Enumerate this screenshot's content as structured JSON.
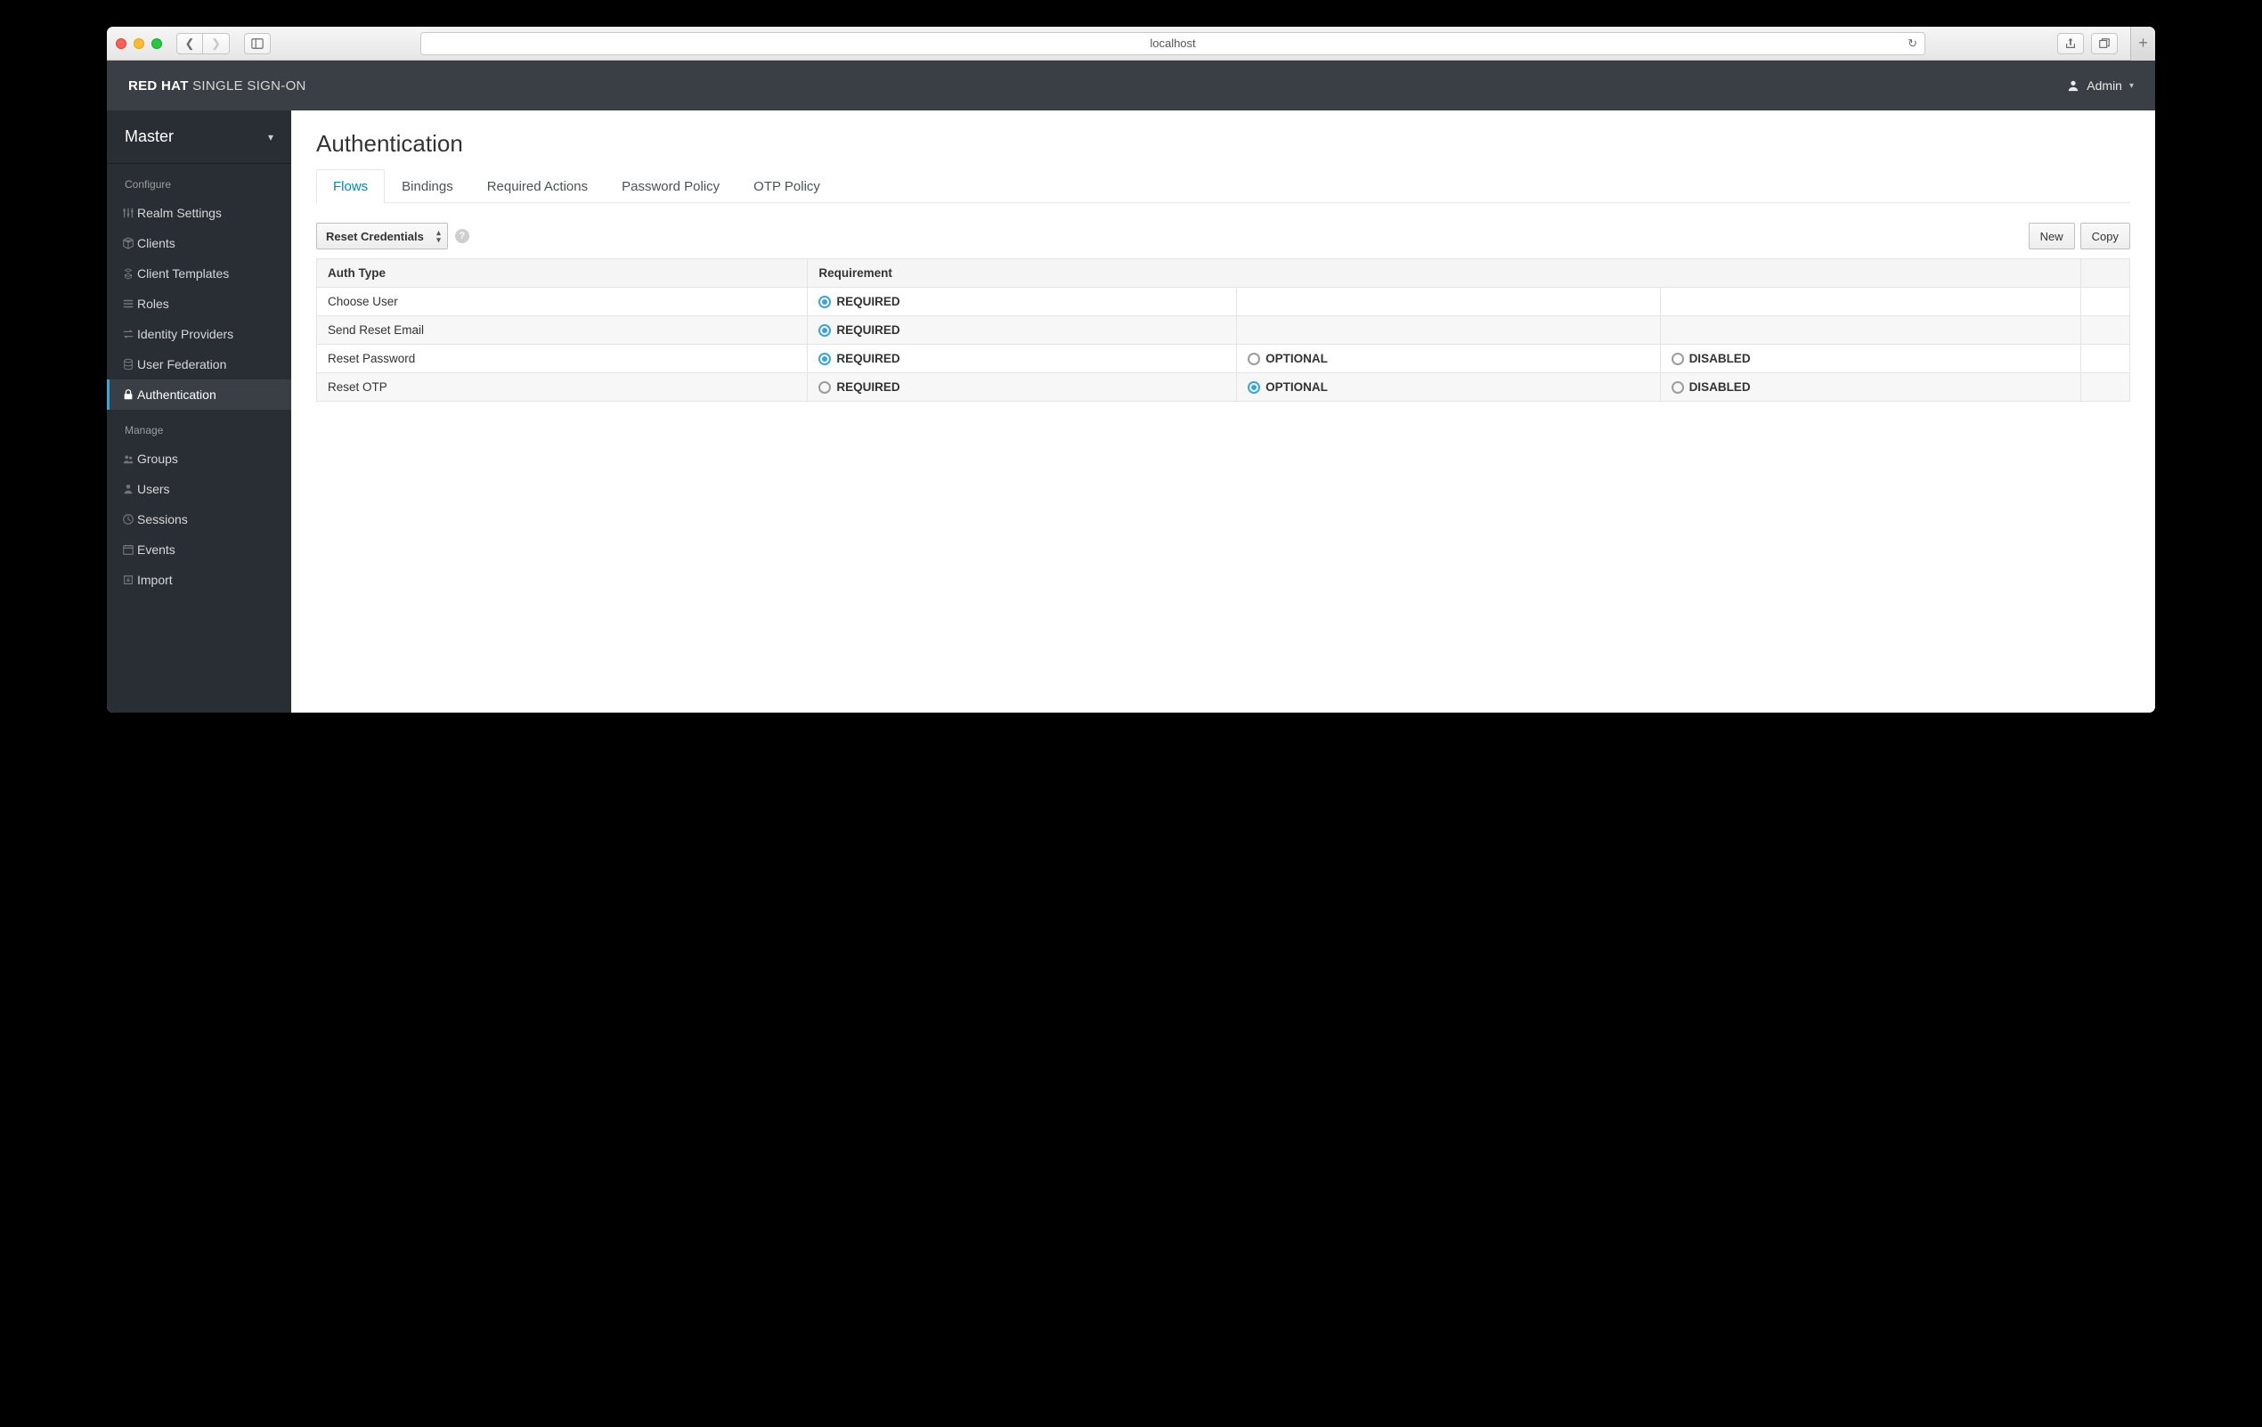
{
  "browser": {
    "address": "localhost"
  },
  "header": {
    "brand_bold": "RED HAT",
    "brand_light": "SINGLE SIGN-ON",
    "user": "Admin"
  },
  "realm": {
    "name": "Master"
  },
  "sidebar": {
    "section_configure": "Configure",
    "section_manage": "Manage",
    "configure": [
      {
        "label": "Realm Settings"
      },
      {
        "label": "Clients"
      },
      {
        "label": "Client Templates"
      },
      {
        "label": "Roles"
      },
      {
        "label": "Identity Providers"
      },
      {
        "label": "User Federation"
      },
      {
        "label": "Authentication"
      }
    ],
    "manage": [
      {
        "label": "Groups"
      },
      {
        "label": "Users"
      },
      {
        "label": "Sessions"
      },
      {
        "label": "Events"
      },
      {
        "label": "Import"
      }
    ]
  },
  "page": {
    "title": "Authentication",
    "tabs": [
      "Flows",
      "Bindings",
      "Required Actions",
      "Password Policy",
      "OTP Policy"
    ],
    "active_tab": 0,
    "flow_selected": "Reset Credentials",
    "buttons": {
      "new": "New",
      "copy": "Copy"
    },
    "columns": {
      "auth_type": "Auth Type",
      "requirement": "Requirement"
    },
    "requirement_labels": {
      "required": "REQUIRED",
      "optional": "OPTIONAL",
      "disabled": "DISABLED"
    },
    "rows": [
      {
        "auth_type": "Choose User",
        "cells": [
          "required"
        ],
        "selected": "required"
      },
      {
        "auth_type": "Send Reset Email",
        "cells": [
          "required"
        ],
        "selected": "required"
      },
      {
        "auth_type": "Reset Password",
        "cells": [
          "required",
          "optional",
          "disabled"
        ],
        "selected": "required"
      },
      {
        "auth_type": "Reset OTP",
        "cells": [
          "required",
          "optional",
          "disabled"
        ],
        "selected": "optional"
      }
    ]
  }
}
